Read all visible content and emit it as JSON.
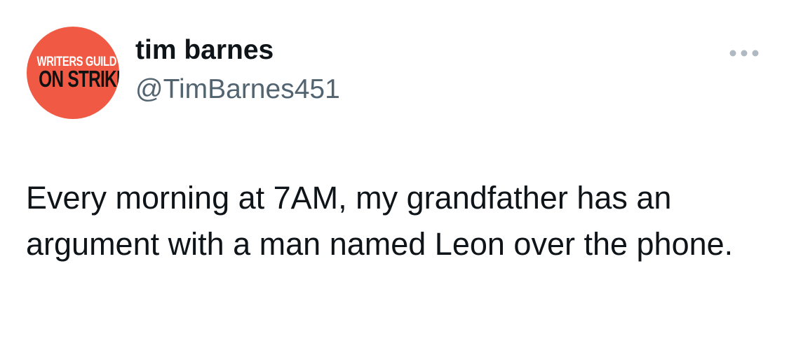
{
  "tweet": {
    "avatar": {
      "line1": "WRITERS GUILD",
      "line2": "ON STRIKE",
      "background_color": "#f05a44"
    },
    "author": {
      "display_name": "tim barnes",
      "handle": "@TimBarnes451"
    },
    "more_icon": "more-horizontal-icon",
    "text": "Every morning at 7AM, my grandfather has an argument with a man named Leon over the phone."
  }
}
